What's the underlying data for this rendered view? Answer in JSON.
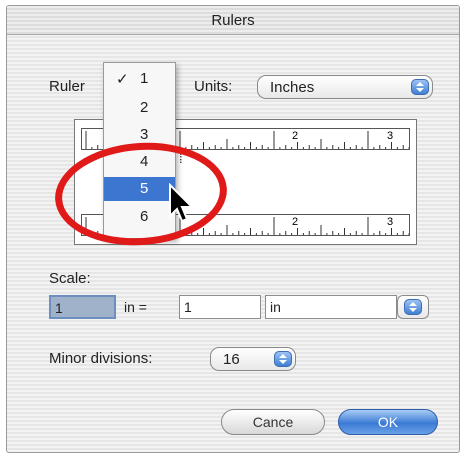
{
  "window": {
    "title": "Rulers"
  },
  "ruler_row": {
    "label": "Ruler",
    "units_label": "Units:",
    "units_value": "Inches"
  },
  "menu": {
    "items": [
      {
        "check": "✓",
        "label": "1"
      },
      {
        "check": "",
        "label": "2"
      },
      {
        "check": "",
        "label": "3"
      },
      {
        "check": "",
        "label": "4"
      },
      {
        "check": "",
        "label": "5"
      },
      {
        "check": "",
        "label": "6"
      }
    ],
    "selected_index": 4
  },
  "preview": {
    "top_labels": [
      "2",
      "3"
    ],
    "bottom_labels": [
      "2",
      "3"
    ]
  },
  "scale": {
    "label": "Scale:",
    "left_value": "1",
    "middle_text": "in =",
    "right_value": "1",
    "unit_value": "in"
  },
  "minor": {
    "label": "Minor divisions:",
    "value": "16"
  },
  "buttons": {
    "cancel": "Cance",
    "ok": "OK"
  },
  "colors": {
    "highlight": "#3d76d1",
    "annotation": "#e01919",
    "accent": "#3f7fd3"
  }
}
